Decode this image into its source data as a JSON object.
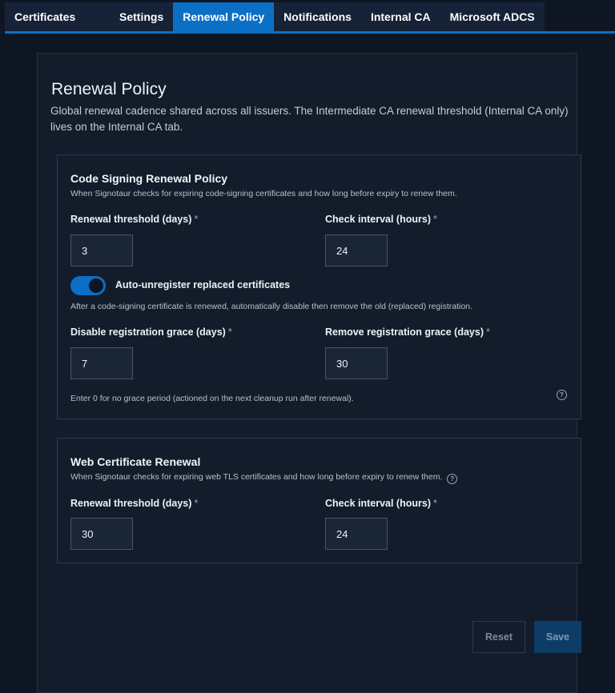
{
  "tabs": {
    "brand": "Certificates",
    "items": [
      {
        "label": "Settings"
      },
      {
        "label": "Renewal Policy"
      },
      {
        "label": "Notifications"
      },
      {
        "label": "Internal CA"
      },
      {
        "label": "Microsoft ADCS"
      }
    ],
    "active": "Renewal Policy"
  },
  "page": {
    "title": "Renewal Policy",
    "description": "Global renewal cadence shared across all issuers. The Intermediate CA renewal threshold (Internal CA only) lives on the Internal CA tab."
  },
  "code_signing": {
    "title": "Code Signing Renewal Policy",
    "description": "When Signotaur checks for expiring code-signing certificates and how long before expiry to renew them.",
    "renewal_threshold_label": "Renewal threshold (days)",
    "renewal_threshold_value": "3",
    "check_interval_label": "Check interval (hours)",
    "check_interval_value": "24",
    "auto_unregister_label": "Auto-unregister replaced certificates",
    "auto_unregister_enabled": true,
    "auto_unregister_help": "After a code-signing certificate is renewed, automatically disable then remove the old (replaced) registration.",
    "disable_grace_label": "Disable registration grace (days)",
    "disable_grace_value": "7",
    "remove_grace_label": "Remove registration grace (days)",
    "remove_grace_value": "30",
    "grace_help": "Enter 0 for no grace period (actioned on the next cleanup run after renewal)."
  },
  "web_cert": {
    "title": "Web Certificate Renewal",
    "description": "When Signotaur checks for expiring web TLS certificates and how long before expiry to renew them.",
    "renewal_threshold_label": "Renewal threshold (days)",
    "renewal_threshold_value": "30",
    "check_interval_label": "Check interval (hours)",
    "check_interval_value": "24"
  },
  "required_marker": "*",
  "help_glyph": "?",
  "actions": {
    "reset_label": "Reset",
    "save_label": "Save"
  },
  "colors": {
    "accent": "#0b6fc6",
    "background": "#0f1623",
    "panel": "#131c2b"
  }
}
